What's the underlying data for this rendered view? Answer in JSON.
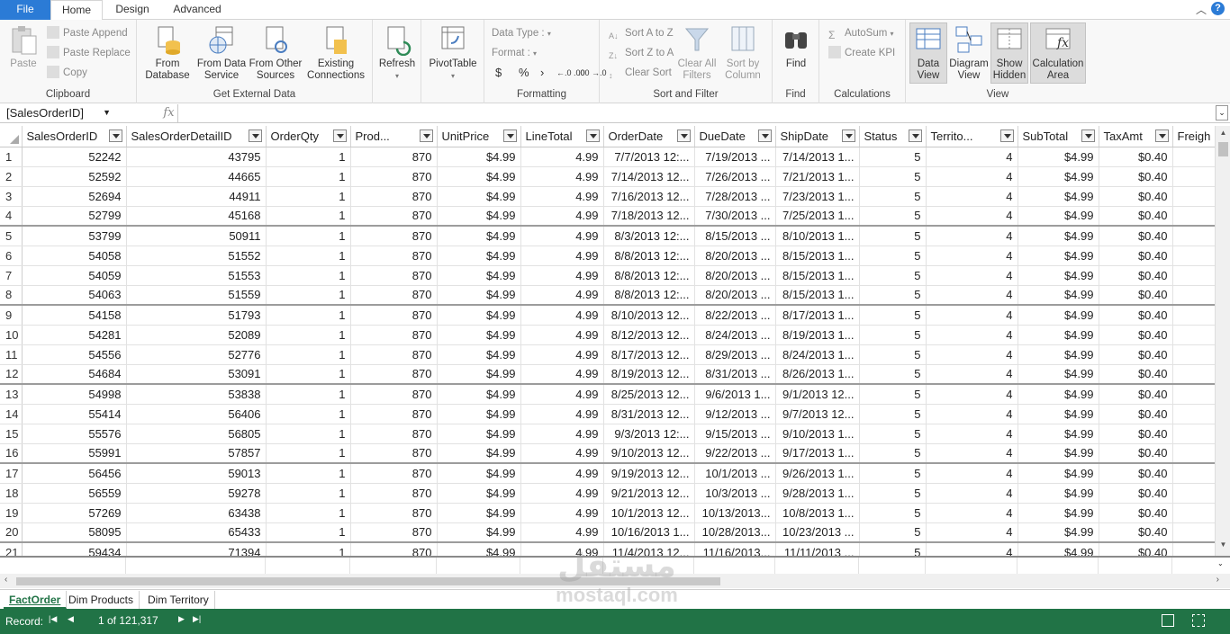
{
  "tabs": {
    "file": "File",
    "home": "Home",
    "design": "Design",
    "advanced": "Advanced"
  },
  "ribbon": {
    "clipboard": {
      "label": "Clipboard",
      "paste": "Paste",
      "paste_append": "Paste Append",
      "paste_replace": "Paste Replace",
      "copy": "Copy"
    },
    "external": {
      "label": "Get External Data",
      "from_database": "From Database",
      "from_data_service": "From Data Service",
      "from_other_sources": "From Other Sources",
      "existing_connections": "Existing Connections"
    },
    "refresh": "Refresh",
    "pivottable": "PivotTable",
    "formatting": {
      "label": "Formatting",
      "data_type": "Data Type :",
      "format": "Format :",
      "dollar": "$",
      "percent": "%",
      "comma": "›",
      "inc_dec": "←.0 .00",
      "dec_dec": ".00 →.0"
    },
    "sort": {
      "label": "Sort and Filter",
      "sort_az": "Sort A to Z",
      "sort_za": "Sort Z to A",
      "clear_sort": "Clear Sort",
      "clear_all_filters": "Clear All Filters",
      "sort_by_column": "Sort by Column"
    },
    "find": {
      "label": "Find",
      "find": "Find"
    },
    "calculations": {
      "label": "Calculations",
      "autosum": "AutoSum",
      "create_kpi": "Create KPI"
    },
    "view": {
      "label": "View",
      "data_view": "Data View",
      "diagram_view": "Diagram View",
      "show_hidden": "Show Hidden",
      "calculation_area": "Calculation Area"
    }
  },
  "formula_bar": {
    "name_box": "[SalesOrderID]",
    "fx": "fx",
    "formula": ""
  },
  "columns": [
    "SalesOrderID",
    "SalesOrderDetailID",
    "OrderQty",
    "Prod...",
    "UnitPrice",
    "LineTotal",
    "OrderDate",
    "DueDate",
    "ShipDate",
    "Status",
    "Territo...",
    "SubTotal",
    "TaxAmt",
    "Freigh"
  ],
  "rows": [
    [
      "1",
      "52242",
      "43795",
      "1",
      "870",
      "$4.99",
      "4.99",
      "7/7/2013 12:...",
      "7/19/2013 ...",
      "7/14/2013 1...",
      "5",
      "4",
      "$4.99",
      "$0.40",
      ""
    ],
    [
      "2",
      "52592",
      "44665",
      "1",
      "870",
      "$4.99",
      "4.99",
      "7/14/2013 12...",
      "7/26/2013 ...",
      "7/21/2013 1...",
      "5",
      "4",
      "$4.99",
      "$0.40",
      ""
    ],
    [
      "3",
      "52694",
      "44911",
      "1",
      "870",
      "$4.99",
      "4.99",
      "7/16/2013 12...",
      "7/28/2013 ...",
      "7/23/2013 1...",
      "5",
      "4",
      "$4.99",
      "$0.40",
      ""
    ],
    [
      "4",
      "52799",
      "45168",
      "1",
      "870",
      "$4.99",
      "4.99",
      "7/18/2013 12...",
      "7/30/2013 ...",
      "7/25/2013 1...",
      "5",
      "4",
      "$4.99",
      "$0.40",
      ""
    ],
    [
      "5",
      "53799",
      "50911",
      "1",
      "870",
      "$4.99",
      "4.99",
      "8/3/2013 12:...",
      "8/15/2013 ...",
      "8/10/2013 1...",
      "5",
      "4",
      "$4.99",
      "$0.40",
      ""
    ],
    [
      "6",
      "54058",
      "51552",
      "1",
      "870",
      "$4.99",
      "4.99",
      "8/8/2013 12:...",
      "8/20/2013 ...",
      "8/15/2013 1...",
      "5",
      "4",
      "$4.99",
      "$0.40",
      ""
    ],
    [
      "7",
      "54059",
      "51553",
      "1",
      "870",
      "$4.99",
      "4.99",
      "8/8/2013 12:...",
      "8/20/2013 ...",
      "8/15/2013 1...",
      "5",
      "4",
      "$4.99",
      "$0.40",
      ""
    ],
    [
      "8",
      "54063",
      "51559",
      "1",
      "870",
      "$4.99",
      "4.99",
      "8/8/2013 12:...",
      "8/20/2013 ...",
      "8/15/2013 1...",
      "5",
      "4",
      "$4.99",
      "$0.40",
      ""
    ],
    [
      "9",
      "54158",
      "51793",
      "1",
      "870",
      "$4.99",
      "4.99",
      "8/10/2013 12...",
      "8/22/2013 ...",
      "8/17/2013 1...",
      "5",
      "4",
      "$4.99",
      "$0.40",
      ""
    ],
    [
      "10",
      "54281",
      "52089",
      "1",
      "870",
      "$4.99",
      "4.99",
      "8/12/2013 12...",
      "8/24/2013 ...",
      "8/19/2013 1...",
      "5",
      "4",
      "$4.99",
      "$0.40",
      ""
    ],
    [
      "11",
      "54556",
      "52776",
      "1",
      "870",
      "$4.99",
      "4.99",
      "8/17/2013 12...",
      "8/29/2013 ...",
      "8/24/2013 1...",
      "5",
      "4",
      "$4.99",
      "$0.40",
      ""
    ],
    [
      "12",
      "54684",
      "53091",
      "1",
      "870",
      "$4.99",
      "4.99",
      "8/19/2013 12...",
      "8/31/2013 ...",
      "8/26/2013 1...",
      "5",
      "4",
      "$4.99",
      "$0.40",
      ""
    ],
    [
      "13",
      "54998",
      "53838",
      "1",
      "870",
      "$4.99",
      "4.99",
      "8/25/2013 12...",
      "9/6/2013 1...",
      "9/1/2013 12...",
      "5",
      "4",
      "$4.99",
      "$0.40",
      ""
    ],
    [
      "14",
      "55414",
      "56406",
      "1",
      "870",
      "$4.99",
      "4.99",
      "8/31/2013 12...",
      "9/12/2013 ...",
      "9/7/2013 12...",
      "5",
      "4",
      "$4.99",
      "$0.40",
      ""
    ],
    [
      "15",
      "55576",
      "56805",
      "1",
      "870",
      "$4.99",
      "4.99",
      "9/3/2013 12:...",
      "9/15/2013 ...",
      "9/10/2013 1...",
      "5",
      "4",
      "$4.99",
      "$0.40",
      ""
    ],
    [
      "16",
      "55991",
      "57857",
      "1",
      "870",
      "$4.99",
      "4.99",
      "9/10/2013 12...",
      "9/22/2013 ...",
      "9/17/2013 1...",
      "5",
      "4",
      "$4.99",
      "$0.40",
      ""
    ],
    [
      "17",
      "56456",
      "59013",
      "1",
      "870",
      "$4.99",
      "4.99",
      "9/19/2013 12...",
      "10/1/2013 ...",
      "9/26/2013 1...",
      "5",
      "4",
      "$4.99",
      "$0.40",
      ""
    ],
    [
      "18",
      "56559",
      "59278",
      "1",
      "870",
      "$4.99",
      "4.99",
      "9/21/2013 12...",
      "10/3/2013 ...",
      "9/28/2013 1...",
      "5",
      "4",
      "$4.99",
      "$0.40",
      ""
    ],
    [
      "19",
      "57269",
      "63438",
      "1",
      "870",
      "$4.99",
      "4.99",
      "10/1/2013 12...",
      "10/13/2013...",
      "10/8/2013 1...",
      "5",
      "4",
      "$4.99",
      "$0.40",
      ""
    ],
    [
      "20",
      "58095",
      "65433",
      "1",
      "870",
      "$4.99",
      "4.99",
      "10/16/2013 1...",
      "10/28/2013...",
      "10/23/2013 ...",
      "5",
      "4",
      "$4.99",
      "$0.40",
      ""
    ],
    [
      "21",
      "59434",
      "71394",
      "1",
      "870",
      "$4.99",
      "4.99",
      "11/4/2013 12...",
      "11/16/2013...",
      "11/11/2013 ...",
      "5",
      "4",
      "$4.99",
      "$0.40",
      ""
    ]
  ],
  "sheets": [
    "FactOrder",
    "Dim Products",
    "Dim Territory"
  ],
  "status": {
    "record_label": "Record:",
    "record_position": "1 of 121,317"
  },
  "watermark": {
    "arabic": "مستقل",
    "latin": "mostaql.com"
  },
  "colors": {
    "accent": "#217346",
    "file_tab": "#2b7bd6"
  }
}
